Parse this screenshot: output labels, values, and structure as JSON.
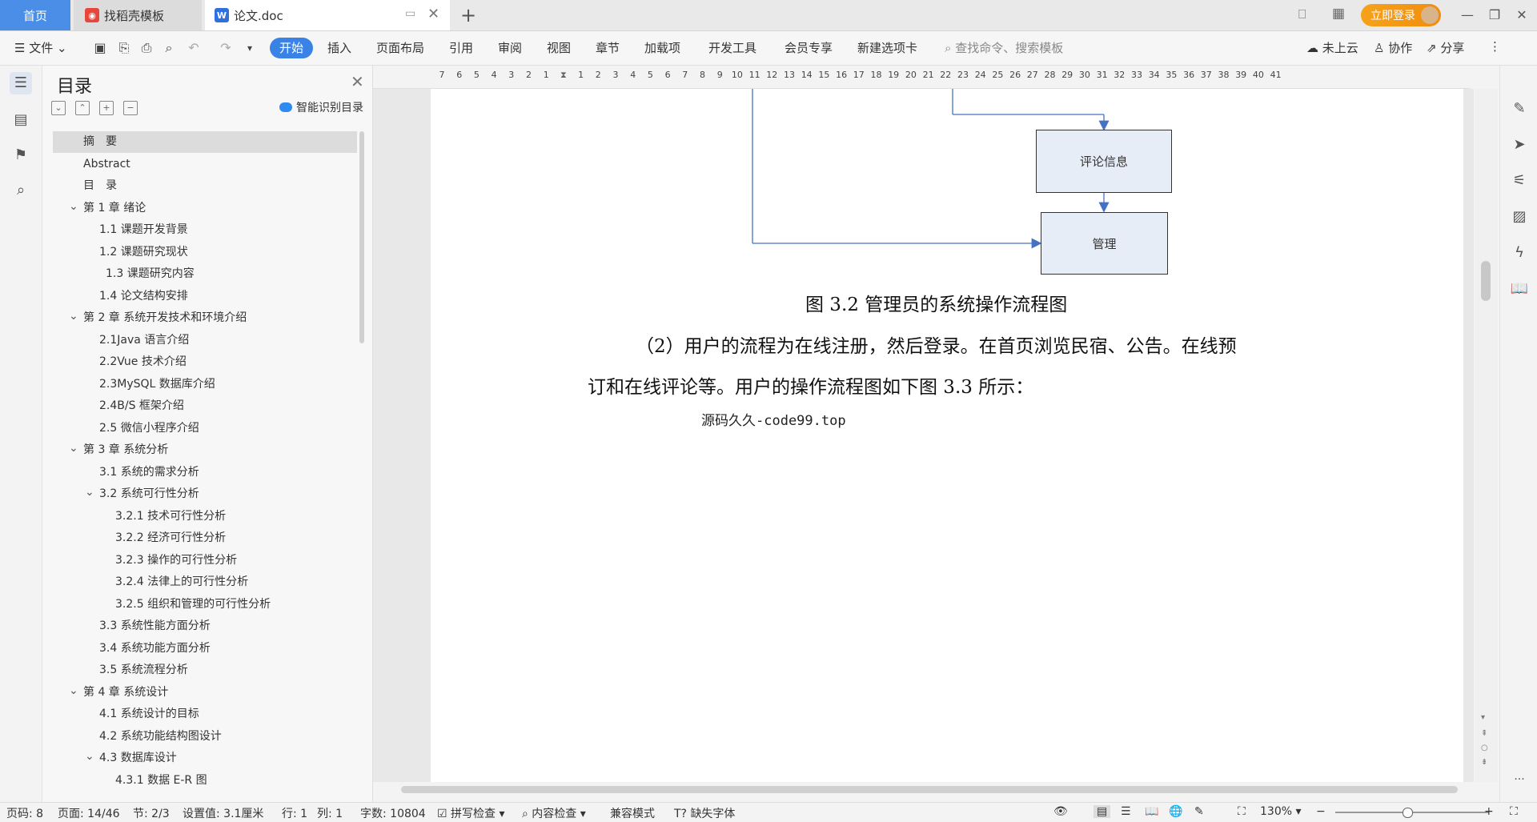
{
  "tabs": {
    "home": "首页",
    "template": "找稻壳模板",
    "document": "论文.doc"
  },
  "login": "立即登录",
  "menu": {
    "file": "文件",
    "start": "开始",
    "items": [
      "插入",
      "页面布局",
      "引用",
      "审阅",
      "视图",
      "章节",
      "加载项",
      "开发工具",
      "会员专享",
      "新建选项卡"
    ],
    "search": "查找命令、搜索模板",
    "cloud": "未上云",
    "collab": "协作",
    "share": "分享"
  },
  "toc": {
    "title": "目录",
    "smart": "智能识别目录",
    "items": [
      {
        "text": "摘　要",
        "level": 0,
        "arrow": false,
        "selected": true
      },
      {
        "text": "Abstract",
        "level": 0,
        "arrow": false
      },
      {
        "text": "目　录",
        "level": 0,
        "arrow": false
      },
      {
        "text": "第 1 章  绪论",
        "level": 0,
        "arrow": true
      },
      {
        "text": "1.1 课题开发背景",
        "level": 1,
        "arrow": false
      },
      {
        "text": "1.2 课题研究现状",
        "level": 1,
        "arrow": false
      },
      {
        "text": "1.3 课题研究内容",
        "level": 1.3,
        "arrow": false
      },
      {
        "text": "1.4 论文结构安排",
        "level": 1,
        "arrow": false
      },
      {
        "text": "第 2 章  系统开发技术和环境介绍",
        "level": 0,
        "arrow": true
      },
      {
        "text": "2.1Java 语言介绍",
        "level": 1,
        "arrow": false
      },
      {
        "text": "2.2Vue 技术介绍",
        "level": 1,
        "arrow": false
      },
      {
        "text": "2.3MySQL 数据库介绍",
        "level": 1,
        "arrow": false
      },
      {
        "text": "2.4B/S 框架介绍",
        "level": 1,
        "arrow": false
      },
      {
        "text": "2.5 微信小程序介绍",
        "level": 1,
        "arrow": false
      },
      {
        "text": "第 3 章  系统分析",
        "level": 0,
        "arrow": true
      },
      {
        "text": "3.1 系统的需求分析",
        "level": 1,
        "arrow": false
      },
      {
        "text": "3.2 系统可行性分析",
        "level": 1,
        "arrow": true
      },
      {
        "text": "3.2.1 技术可行性分析",
        "level": 2,
        "arrow": false
      },
      {
        "text": "3.2.2 经济可行性分析",
        "level": 2,
        "arrow": false
      },
      {
        "text": "3.2.3 操作的可行性分析",
        "level": 2,
        "arrow": false
      },
      {
        "text": "3.2.4 法律上的可行性分析",
        "level": 2,
        "arrow": false
      },
      {
        "text": "3.2.5 组织和管理的可行性分析",
        "level": 2,
        "arrow": false
      },
      {
        "text": "3.3 系统性能方面分析",
        "level": 1,
        "arrow": false
      },
      {
        "text": "3.4 系统功能方面分析",
        "level": 1,
        "arrow": false
      },
      {
        "text": "3.5 系统流程分析",
        "level": 1,
        "arrow": false
      },
      {
        "text": "第 4 章  系统设计",
        "level": 0,
        "arrow": true
      },
      {
        "text": "4.1 系统设计的目标",
        "level": 1,
        "arrow": false
      },
      {
        "text": "4.2 系统功能结构图设计",
        "level": 1,
        "arrow": false
      },
      {
        "text": "4.3 数据库设计",
        "level": 1,
        "arrow": true
      },
      {
        "text": "4.3.1 数据 E-R 图",
        "level": 2,
        "arrow": false
      }
    ]
  },
  "ruler": [
    "7",
    "6",
    "5",
    "4",
    "3",
    "2",
    "1",
    "",
    "1",
    "2",
    "3",
    "4",
    "5",
    "6",
    "7",
    "8",
    "9",
    "10",
    "11",
    "12",
    "13",
    "14",
    "15",
    "16",
    "17",
    "18",
    "19",
    "20",
    "21",
    "22",
    "23",
    "24",
    "25",
    "26",
    "27",
    "28",
    "29",
    "30",
    "31",
    "32",
    "33",
    "34",
    "35",
    "36",
    "37",
    "38",
    "39",
    "40",
    "41"
  ],
  "doc": {
    "box_comment": "评论信息",
    "box_manage": "管理",
    "caption": "图 3.2 管理员的系统操作流程图",
    "para_line1": "（2）用户的流程为在线注册，然后登录。在首页浏览民宿、公告。在线预",
    "para_line2": "订和在线评论等。用户的操作流程图如下图 3.3 所示：",
    "watermark": "源码久久-code99.top"
  },
  "status": {
    "page_code": "页码: 8",
    "page": "页面: 14/46",
    "section": "节: 2/3",
    "setting": "设置值: 3.1厘米",
    "row": "行: 1",
    "col": "列: 1",
    "words": "字数: 10804",
    "spell": "拼写检查",
    "content": "内容检查",
    "compat": "兼容模式",
    "font_missing": "缺失字体",
    "zoom": "130%"
  }
}
